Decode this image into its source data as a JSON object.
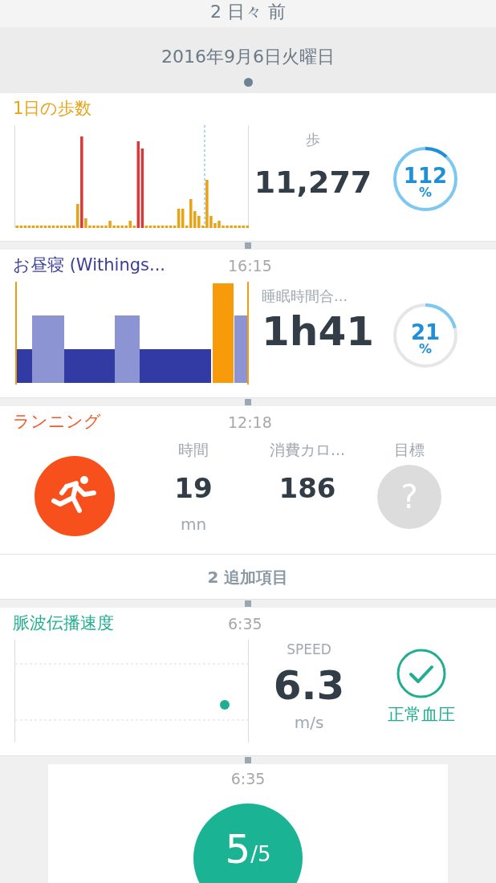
{
  "history_header": {
    "label": "2 日々 前"
  },
  "date": "2016年9月6日火曜日",
  "cards": [
    {
      "kind": "steps",
      "title": "1日の歩数",
      "stat_label": "歩",
      "value": "11,277",
      "ring": {
        "label": "112",
        "unit": "%"
      }
    },
    {
      "kind": "sleep",
      "title": "お昼寝 (Withings...",
      "time": "16:15",
      "stat_label": "睡眠時間合...",
      "value": "1h41",
      "ring": {
        "label": "21",
        "unit": "%"
      }
    },
    {
      "kind": "activity",
      "title": "ランニング",
      "time": "12:18",
      "stats": [
        {
          "label": "時間",
          "value": "19",
          "unit": "mn"
        },
        {
          "label": "消費カロ...",
          "value": "186"
        }
      ],
      "goal": {
        "label": "目標",
        "symbol": "?"
      }
    },
    {
      "kind": "more",
      "label": "2 追加項目"
    },
    {
      "kind": "pwv",
      "title": "脈波伝播速度",
      "time": "6:35",
      "stat_label": "SPEED",
      "value": "6.3",
      "unit": "m/s",
      "status": "正常血圧"
    },
    {
      "kind": "score",
      "time": "6:35",
      "score": "5",
      "total": "/5"
    }
  ]
}
